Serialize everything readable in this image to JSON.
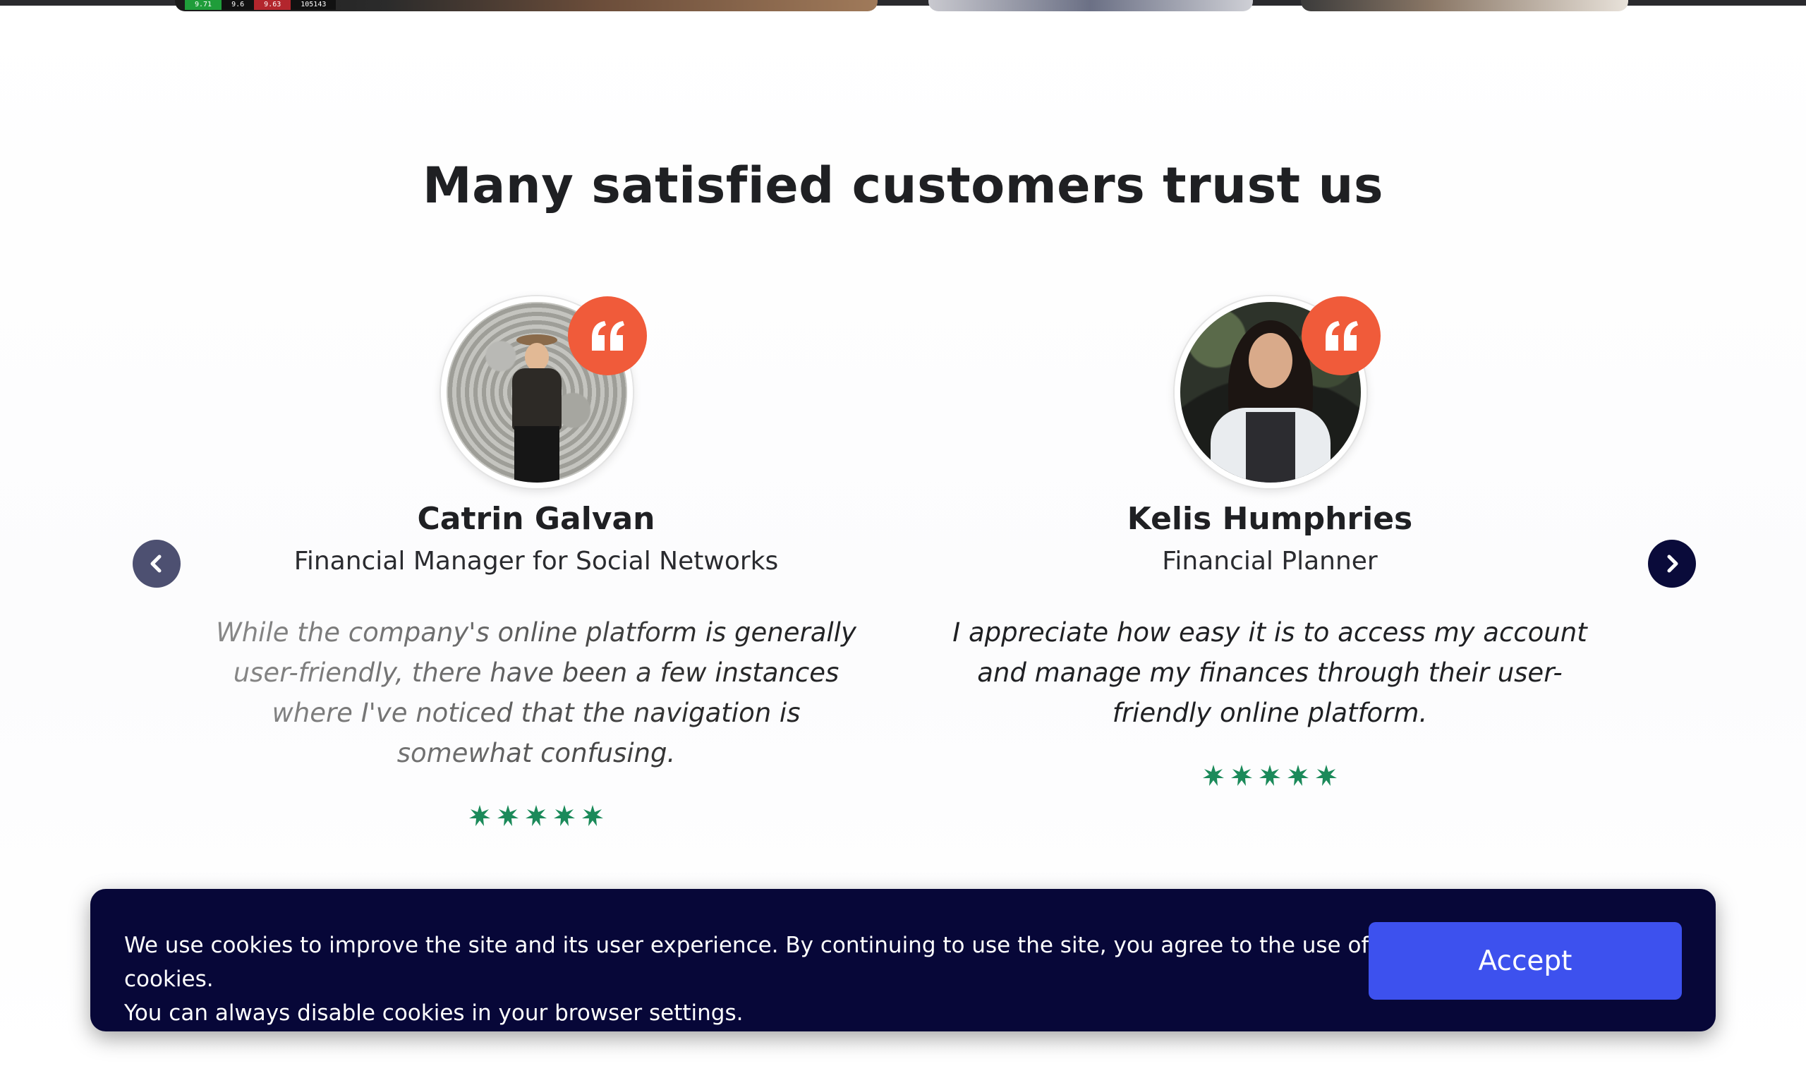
{
  "top_ticker": [
    "9.71",
    "9.6",
    "9.63",
    "105143"
  ],
  "section": {
    "heading": "Many satisfied customers trust us"
  },
  "testimonials": [
    {
      "name": "Catrin Galvan",
      "role": "Financial Manager for Social Networks",
      "quote": "While the company's online platform is generally user-friendly, there have been a few instances where I've noticed that the navigation is somewhat confusing.",
      "rating": 5
    },
    {
      "name": "Kelis Humphries",
      "role": "Financial Planner",
      "quote": "I appreciate how easy it is to access my account and manage my finances through their user-friendly online platform.",
      "rating": 5
    }
  ],
  "carousel": {
    "prev_icon": "chevron-left-icon",
    "next_icon": "chevron-right-icon"
  },
  "cookie_banner": {
    "line1": "We use cookies to improve the site and its user experience. By continuing to use the site, you agree to the use of cookies.",
    "line2": "You can always disable cookies in your browser settings.",
    "accept_label": "Accept"
  },
  "colors": {
    "quote_badge": "#f05b3a",
    "star": "#1b8a5a",
    "cookie_bg": "#070738",
    "accept_bg": "#3d51ee",
    "nav_prev": "#4d5071",
    "nav_next": "#0a0b3a"
  }
}
